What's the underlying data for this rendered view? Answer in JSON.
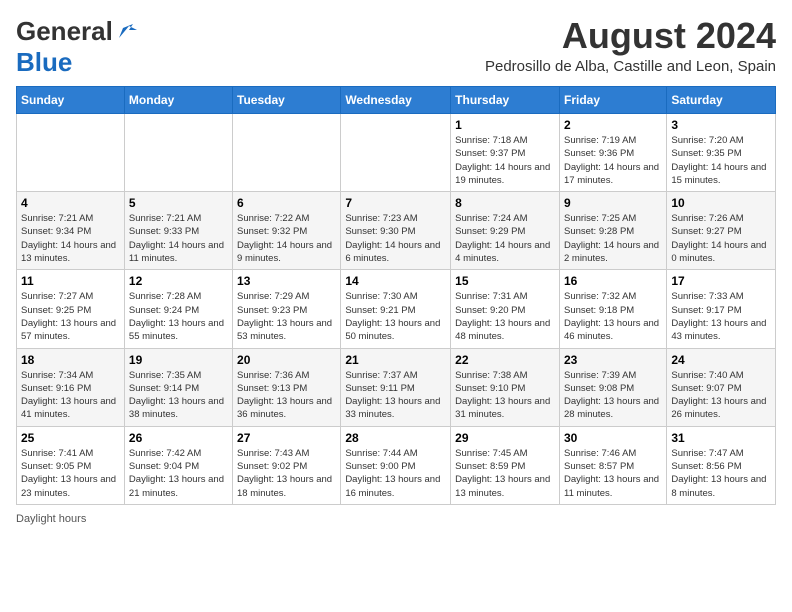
{
  "header": {
    "logo_general": "General",
    "logo_blue": "Blue",
    "month_year": "August 2024",
    "location": "Pedrosillo de Alba, Castille and Leon, Spain"
  },
  "weekdays": [
    "Sunday",
    "Monday",
    "Tuesday",
    "Wednesday",
    "Thursday",
    "Friday",
    "Saturday"
  ],
  "footer": {
    "daylight_label": "Daylight hours"
  },
  "weeks": [
    [
      {
        "day": "",
        "info": ""
      },
      {
        "day": "",
        "info": ""
      },
      {
        "day": "",
        "info": ""
      },
      {
        "day": "",
        "info": ""
      },
      {
        "day": "1",
        "info": "Sunrise: 7:18 AM\nSunset: 9:37 PM\nDaylight: 14 hours\nand 19 minutes."
      },
      {
        "day": "2",
        "info": "Sunrise: 7:19 AM\nSunset: 9:36 PM\nDaylight: 14 hours\nand 17 minutes."
      },
      {
        "day": "3",
        "info": "Sunrise: 7:20 AM\nSunset: 9:35 PM\nDaylight: 14 hours\nand 15 minutes."
      }
    ],
    [
      {
        "day": "4",
        "info": "Sunrise: 7:21 AM\nSunset: 9:34 PM\nDaylight: 14 hours\nand 13 minutes."
      },
      {
        "day": "5",
        "info": "Sunrise: 7:21 AM\nSunset: 9:33 PM\nDaylight: 14 hours\nand 11 minutes."
      },
      {
        "day": "6",
        "info": "Sunrise: 7:22 AM\nSunset: 9:32 PM\nDaylight: 14 hours\nand 9 minutes."
      },
      {
        "day": "7",
        "info": "Sunrise: 7:23 AM\nSunset: 9:30 PM\nDaylight: 14 hours\nand 6 minutes."
      },
      {
        "day": "8",
        "info": "Sunrise: 7:24 AM\nSunset: 9:29 PM\nDaylight: 14 hours\nand 4 minutes."
      },
      {
        "day": "9",
        "info": "Sunrise: 7:25 AM\nSunset: 9:28 PM\nDaylight: 14 hours\nand 2 minutes."
      },
      {
        "day": "10",
        "info": "Sunrise: 7:26 AM\nSunset: 9:27 PM\nDaylight: 14 hours\nand 0 minutes."
      }
    ],
    [
      {
        "day": "11",
        "info": "Sunrise: 7:27 AM\nSunset: 9:25 PM\nDaylight: 13 hours\nand 57 minutes."
      },
      {
        "day": "12",
        "info": "Sunrise: 7:28 AM\nSunset: 9:24 PM\nDaylight: 13 hours\nand 55 minutes."
      },
      {
        "day": "13",
        "info": "Sunrise: 7:29 AM\nSunset: 9:23 PM\nDaylight: 13 hours\nand 53 minutes."
      },
      {
        "day": "14",
        "info": "Sunrise: 7:30 AM\nSunset: 9:21 PM\nDaylight: 13 hours\nand 50 minutes."
      },
      {
        "day": "15",
        "info": "Sunrise: 7:31 AM\nSunset: 9:20 PM\nDaylight: 13 hours\nand 48 minutes."
      },
      {
        "day": "16",
        "info": "Sunrise: 7:32 AM\nSunset: 9:18 PM\nDaylight: 13 hours\nand 46 minutes."
      },
      {
        "day": "17",
        "info": "Sunrise: 7:33 AM\nSunset: 9:17 PM\nDaylight: 13 hours\nand 43 minutes."
      }
    ],
    [
      {
        "day": "18",
        "info": "Sunrise: 7:34 AM\nSunset: 9:16 PM\nDaylight: 13 hours\nand 41 minutes."
      },
      {
        "day": "19",
        "info": "Sunrise: 7:35 AM\nSunset: 9:14 PM\nDaylight: 13 hours\nand 38 minutes."
      },
      {
        "day": "20",
        "info": "Sunrise: 7:36 AM\nSunset: 9:13 PM\nDaylight: 13 hours\nand 36 minutes."
      },
      {
        "day": "21",
        "info": "Sunrise: 7:37 AM\nSunset: 9:11 PM\nDaylight: 13 hours\nand 33 minutes."
      },
      {
        "day": "22",
        "info": "Sunrise: 7:38 AM\nSunset: 9:10 PM\nDaylight: 13 hours\nand 31 minutes."
      },
      {
        "day": "23",
        "info": "Sunrise: 7:39 AM\nSunset: 9:08 PM\nDaylight: 13 hours\nand 28 minutes."
      },
      {
        "day": "24",
        "info": "Sunrise: 7:40 AM\nSunset: 9:07 PM\nDaylight: 13 hours\nand 26 minutes."
      }
    ],
    [
      {
        "day": "25",
        "info": "Sunrise: 7:41 AM\nSunset: 9:05 PM\nDaylight: 13 hours\nand 23 minutes."
      },
      {
        "day": "26",
        "info": "Sunrise: 7:42 AM\nSunset: 9:04 PM\nDaylight: 13 hours\nand 21 minutes."
      },
      {
        "day": "27",
        "info": "Sunrise: 7:43 AM\nSunset: 9:02 PM\nDaylight: 13 hours\nand 18 minutes."
      },
      {
        "day": "28",
        "info": "Sunrise: 7:44 AM\nSunset: 9:00 PM\nDaylight: 13 hours\nand 16 minutes."
      },
      {
        "day": "29",
        "info": "Sunrise: 7:45 AM\nSunset: 8:59 PM\nDaylight: 13 hours\nand 13 minutes."
      },
      {
        "day": "30",
        "info": "Sunrise: 7:46 AM\nSunset: 8:57 PM\nDaylight: 13 hours\nand 11 minutes."
      },
      {
        "day": "31",
        "info": "Sunrise: 7:47 AM\nSunset: 8:56 PM\nDaylight: 13 hours\nand 8 minutes."
      }
    ]
  ]
}
